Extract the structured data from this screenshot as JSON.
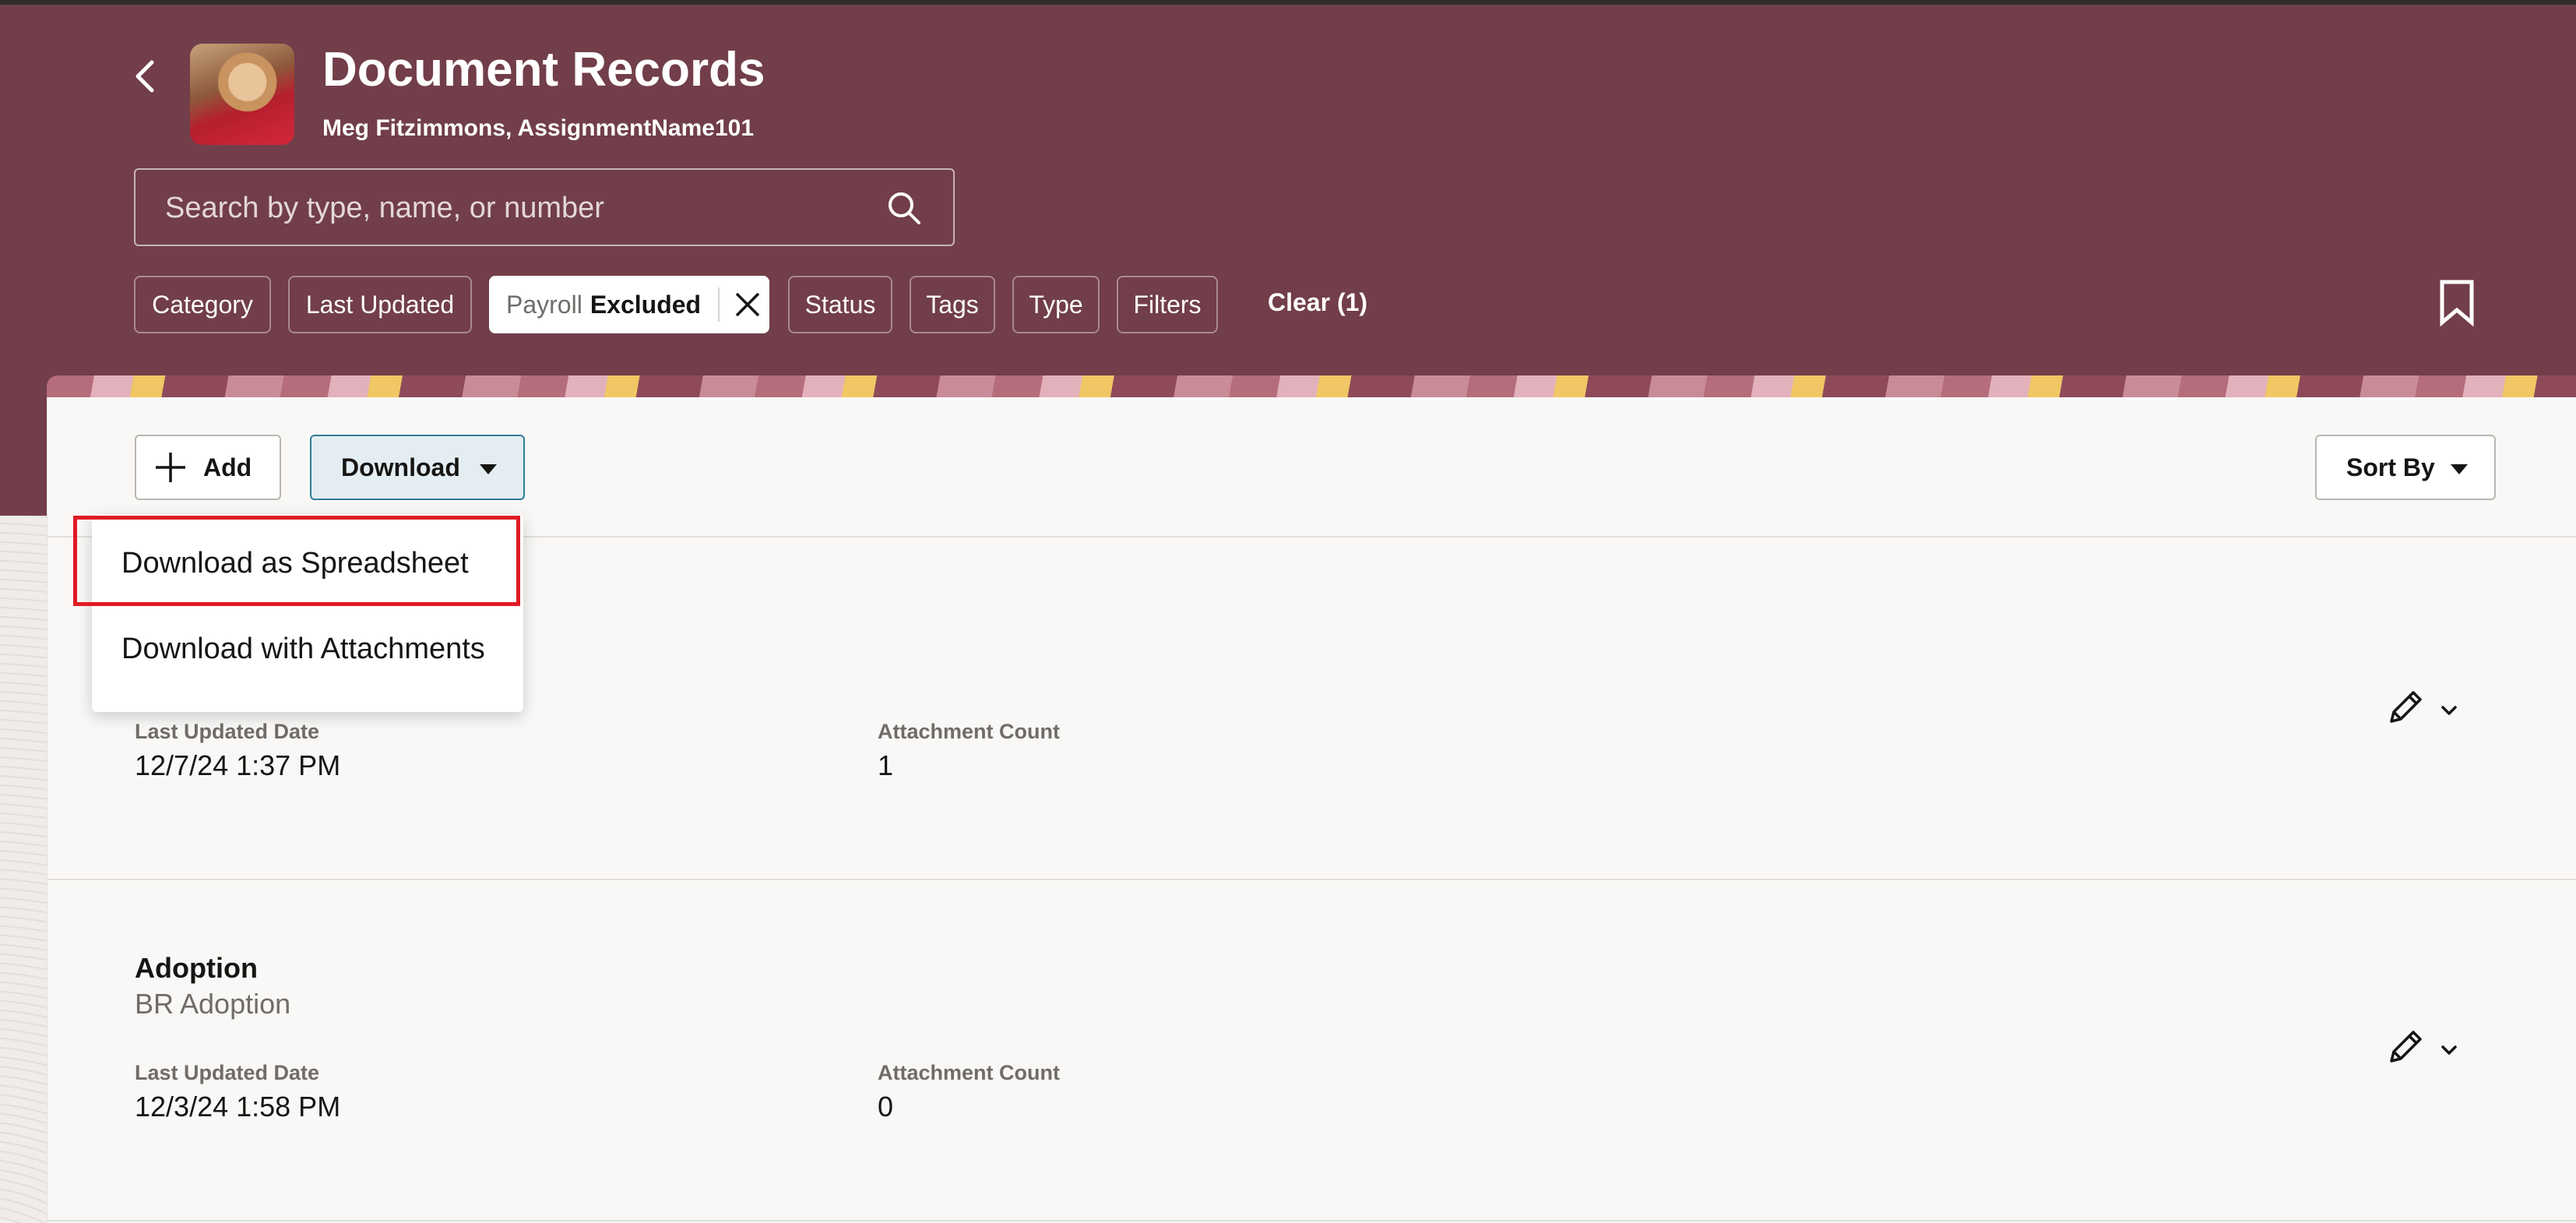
{
  "header": {
    "title": "Document Records",
    "subtitle": "Meg Fitzimmons, AssignmentName101",
    "search_placeholder": "Search by type, name, or number"
  },
  "filters": {
    "category": "Category",
    "last_updated": "Last Updated",
    "payroll_label": "Payroll",
    "payroll_value": "Excluded",
    "status": "Status",
    "tags": "Tags",
    "type": "Type",
    "filters": "Filters",
    "clear": "Clear (1)"
  },
  "toolbar": {
    "add": "Add",
    "download": "Download",
    "sort_by": "Sort By"
  },
  "download_menu": {
    "items": [
      "Download as Spreadsheet",
      "Download with Attachments"
    ]
  },
  "records": [
    {
      "title": "",
      "subtitle": "",
      "last_updated_label": "Last Updated Date",
      "last_updated": "12/7/24 1:37 PM",
      "attachment_label": "Attachment Count",
      "attachment_count": "1"
    },
    {
      "title": "Adoption",
      "subtitle": "BR Adoption",
      "last_updated_label": "Last Updated Date",
      "last_updated": "12/3/24 1:58 PM",
      "attachment_label": "Attachment Count",
      "attachment_count": "0"
    }
  ],
  "colors": {
    "header_bg": "#713e4a",
    "accent": "#2f7c98",
    "highlight": "#e01b24"
  },
  "icons": [
    "back-arrow-icon",
    "search-icon",
    "close-icon",
    "bookmark-icon",
    "plus-icon",
    "caret-down-icon",
    "pencil-icon",
    "chevron-down-icon"
  ]
}
